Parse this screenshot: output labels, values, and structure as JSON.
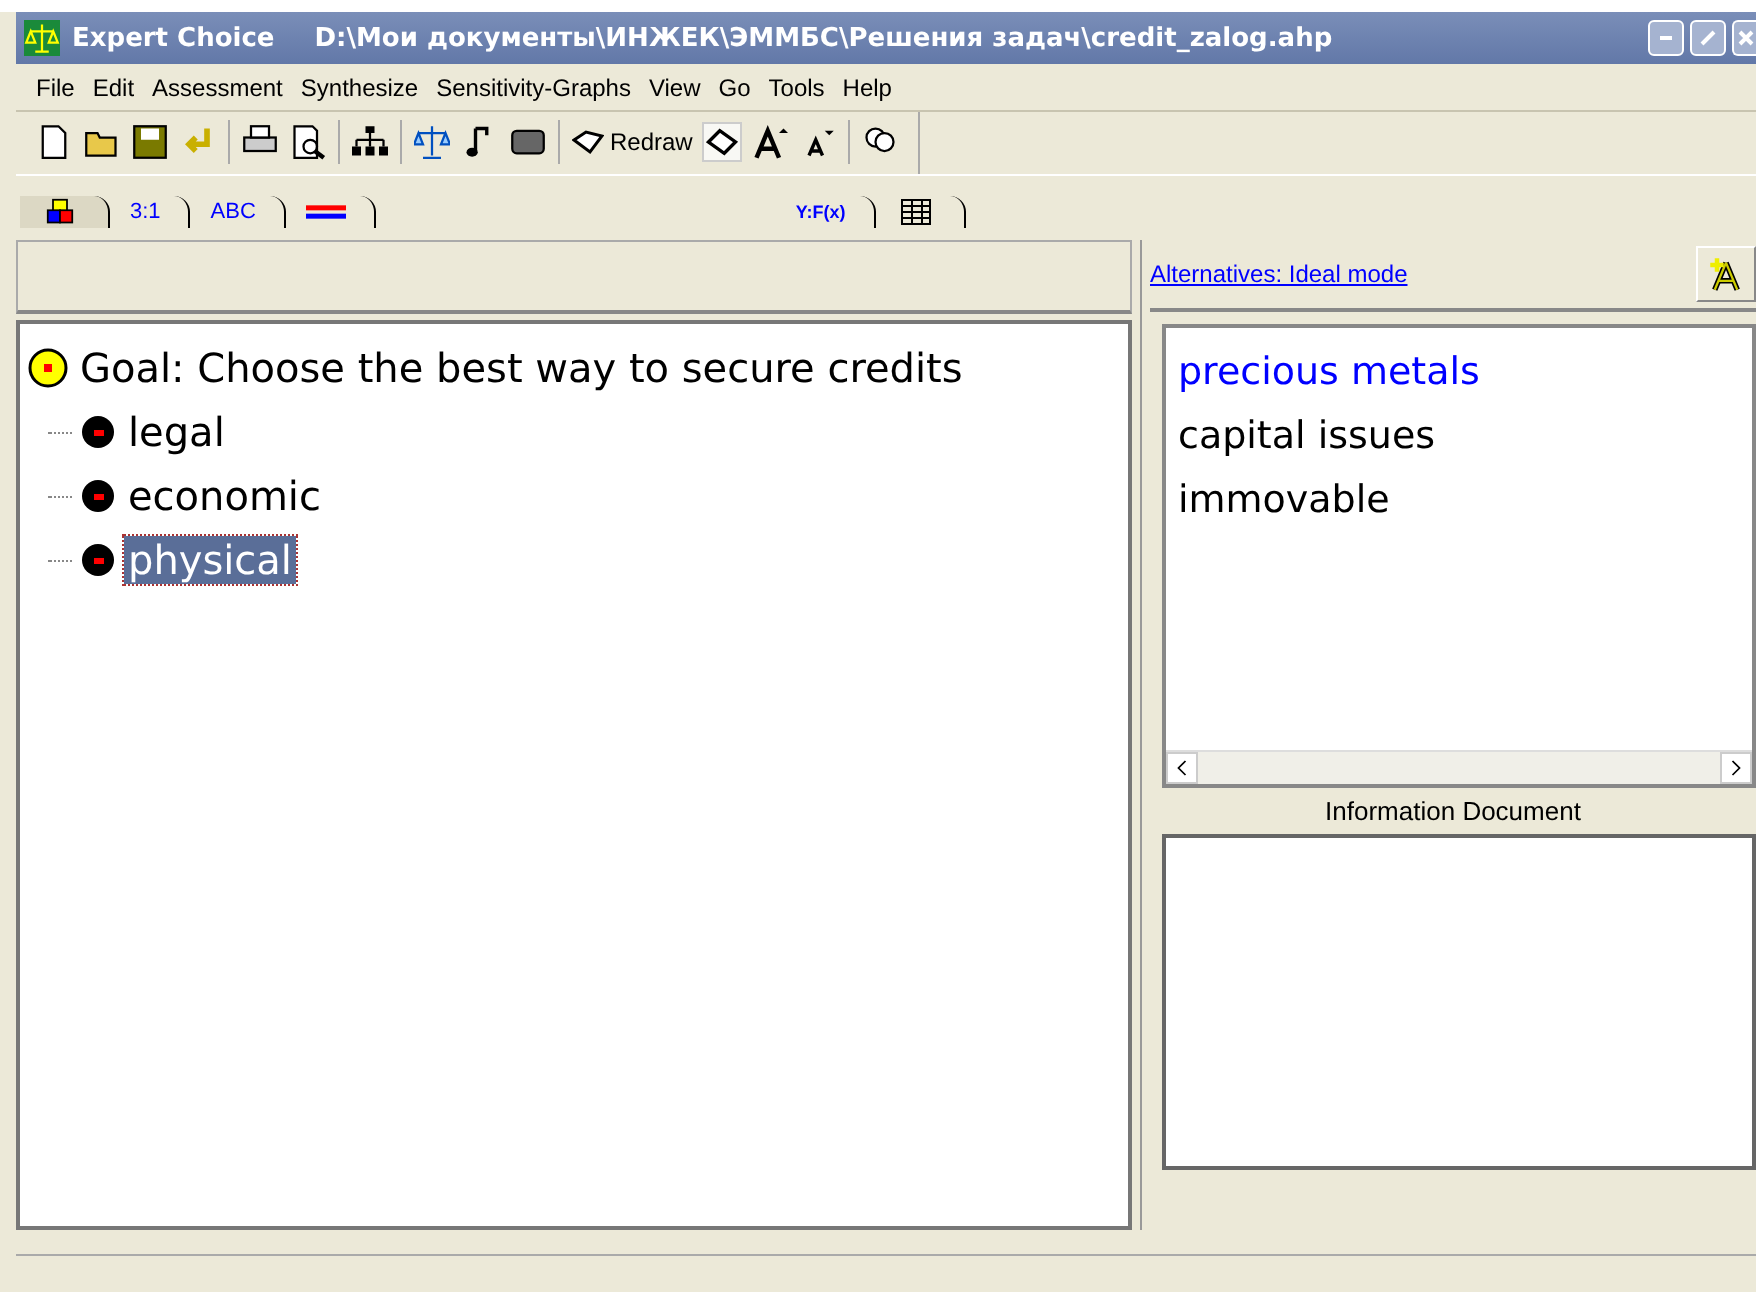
{
  "window": {
    "title": "Expert Choice",
    "path": "D:\\Мои документы\\ИНЖЕК\\ЭММБС\\Решения задач\\credit_zalog.ahp"
  },
  "menu": [
    "File",
    "Edit",
    "Assessment",
    "Synthesize",
    "Sensitivity-Graphs",
    "View",
    "Go",
    "Tools",
    "Help"
  ],
  "toolbar": {
    "redraw": "Redraw"
  },
  "tabs": [
    {
      "kind": "icon",
      "selected": true
    },
    {
      "kind": "text",
      "label": "3:1",
      "selected": false
    },
    {
      "kind": "text",
      "label": "ABC",
      "selected": false
    },
    {
      "kind": "lines",
      "selected": false
    },
    {
      "kind": "formula",
      "label": "Y:F(x)",
      "selected": false
    },
    {
      "kind": "grid",
      "selected": false
    }
  ],
  "tree": {
    "label": "Goal: Choose the best way to secure credits",
    "children": [
      {
        "label": "legal",
        "selected": false
      },
      {
        "label": "economic",
        "selected": false
      },
      {
        "label": "physical",
        "selected": true
      }
    ]
  },
  "alternatives": {
    "link": "Alternatives: Ideal mode",
    "items": [
      {
        "label": "precious metals",
        "selected": true
      },
      {
        "label": "capital issues",
        "selected": false
      },
      {
        "label": "immovable",
        "selected": false
      }
    ]
  },
  "info": {
    "label": "Information Document"
  }
}
